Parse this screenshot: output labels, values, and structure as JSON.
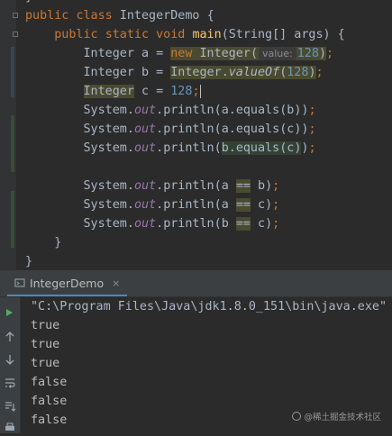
{
  "editor": {
    "lines": [
      "}",
      "public class IntegerDemo {",
      "public static void main(String[] args) {",
      "Integer a = new Integer( value: 128);",
      "Integer b = Integer.valueOf(128);",
      "Integer c = 128;",
      "System.out.println(a.equals(b));",
      "System.out.println(a.equals(c));",
      "System.out.println(b.equals(c));",
      "System.out.println(a == b);",
      "System.out.println(a == c);",
      "System.out.println(b == c);",
      "}",
      "}"
    ],
    "tokens": {
      "public": "public",
      "class": "class",
      "static": "static",
      "void": "void",
      "new": "new",
      "class_name": "IntegerDemo",
      "method_main": "main",
      "main_params": "(String[] args) {",
      "type_integer": "Integer",
      "var_a": "a",
      "var_b": "b",
      "var_c": "c",
      "assign": "=",
      "hint_value": "value:",
      "num_128": "128",
      "value_of": "valueOf",
      "system": "System",
      "out": "out",
      "println": "println",
      "equals": "equals",
      "op_eq": "==",
      "open_brace": "{",
      "close_brace": "}"
    }
  },
  "run_panel": {
    "tab_label": "IntegerDemo",
    "close_label": "×",
    "command": "\"C:\\Program Files\\Java\\jdk1.8.0_151\\bin\\java.exe\"",
    "output": [
      "true",
      "true",
      "true",
      "false",
      "false",
      "false"
    ]
  },
  "toolbar": {
    "icons": [
      "rerun-icon",
      "scroll-up-icon",
      "scroll-down-icon",
      "soft-wrap-icon",
      "scroll-to-end-icon",
      "print-icon",
      "trash-icon"
    ]
  },
  "watermark": {
    "text": "@稀土掘金技术社区"
  },
  "colors": {
    "background": "#2b2b2b",
    "keyword": "#cc7832",
    "method": "#ffc66d",
    "number": "#6897bb",
    "field": "#9876aa",
    "text": "#a9b7c6",
    "console_text": "#bbbbbb",
    "accent": "#4a88c7"
  }
}
